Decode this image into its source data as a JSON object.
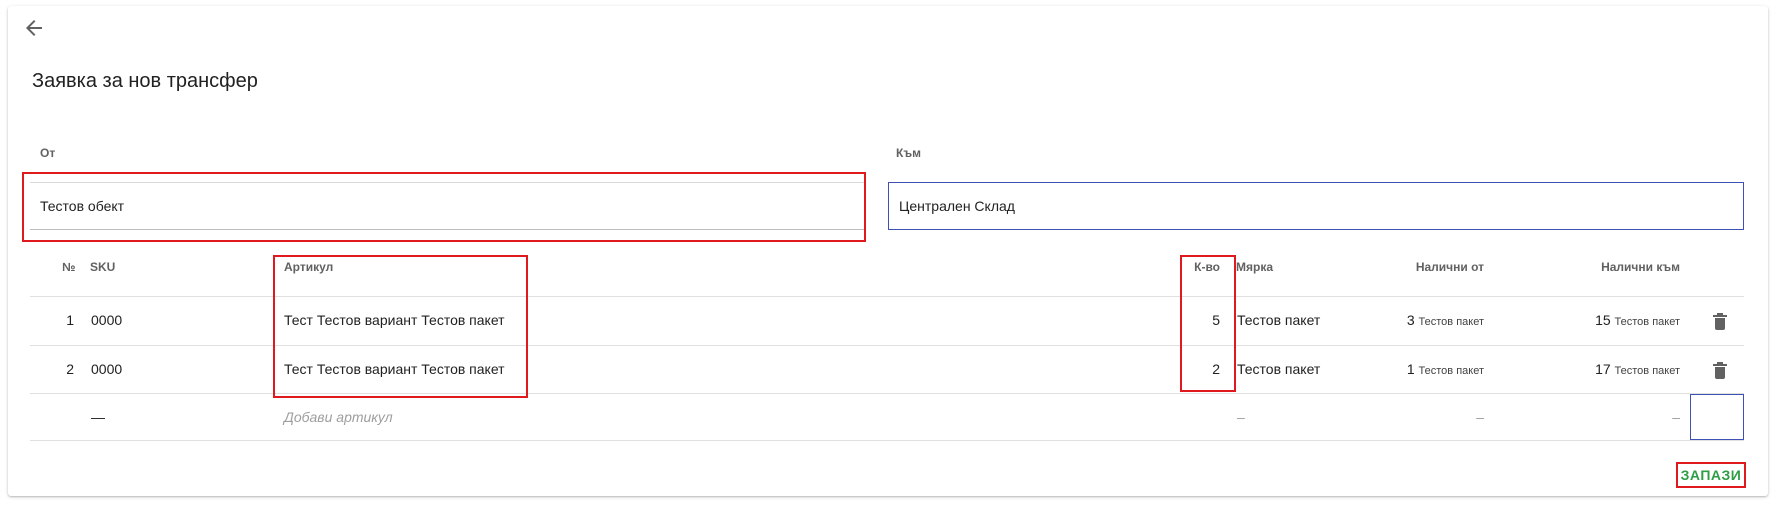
{
  "title": "Заявка за нов трансфер",
  "from": {
    "label": "От",
    "value": "Тестов обект"
  },
  "to": {
    "label": "Към",
    "value": "Централен Склад"
  },
  "table": {
    "headers": {
      "no": "№",
      "sku": "SKU",
      "article": "Артикул",
      "qty": "К-во",
      "unit": "Мярка",
      "available_from": "Налични от",
      "available_to": "Налични към"
    },
    "rows": [
      {
        "no": "1",
        "sku": "0000",
        "article": "Тест Тестов вариант Тестов пакет",
        "qty": "5",
        "unit": "Тестов пакет",
        "avail_from_num": "3",
        "avail_from_unit": "Тестов пакет",
        "avail_to_num": "15",
        "avail_to_unit": "Тестов пакет"
      },
      {
        "no": "2",
        "sku": "0000",
        "article": "Тест Тестов вариант Тестов пакет",
        "qty": "2",
        "unit": "Тестов пакет",
        "avail_from_num": "1",
        "avail_from_unit": "Тестов пакет",
        "avail_to_num": "17",
        "avail_to_unit": "Тестов пакет"
      }
    ],
    "add_row": {
      "sku": "—",
      "article_placeholder": "Добави артикул",
      "unit": "–",
      "available_from": "–",
      "available_to": "–"
    }
  },
  "save_label": "ЗАПАЗИ",
  "colors": {
    "accent": "#3f51b5",
    "save": "#2e9e45",
    "highlight": "#e0191f"
  },
  "icons": {
    "back": "arrow-left-icon",
    "delete": "trash-icon"
  }
}
